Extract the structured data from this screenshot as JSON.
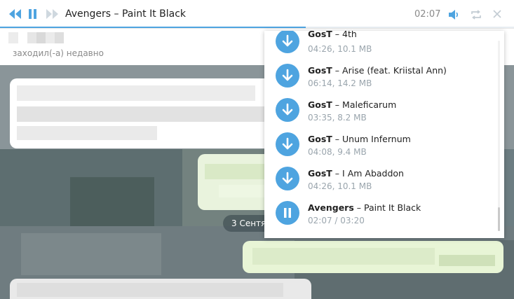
{
  "player": {
    "title": "Avengers – Paint It Black",
    "time": "02:07",
    "progress_fraction": 0.6
  },
  "chat": {
    "status": "заходил(-а) недавно",
    "date_label": "3 Сентя"
  },
  "playlist": {
    "items": [
      {
        "artist": "GosT",
        "song": "4th",
        "meta": "04:26, 10.1 MB",
        "state": "download"
      },
      {
        "artist": "GosT",
        "song": "Arise (feat. Kriistal Ann)",
        "meta": "06:14, 14.2 MB",
        "state": "download"
      },
      {
        "artist": "GosT",
        "song": "Maleficarum",
        "meta": "03:35, 8.2 MB",
        "state": "download"
      },
      {
        "artist": "GosT",
        "song": "Unum Infernum",
        "meta": "04:08, 9.4 MB",
        "state": "download"
      },
      {
        "artist": "GosT",
        "song": "I Am Abaddon",
        "meta": "04:26, 10.1 MB",
        "state": "download"
      },
      {
        "artist": "Avengers",
        "song": "Paint It Black",
        "meta": "02:07 / 03:20",
        "state": "playing"
      }
    ],
    "separator": " – "
  },
  "colors": {
    "accent": "#4ea4e0",
    "muted_text": "#9aa5ad"
  },
  "icons": {
    "download": "download-arrow-icon",
    "pause": "pause-icon"
  }
}
